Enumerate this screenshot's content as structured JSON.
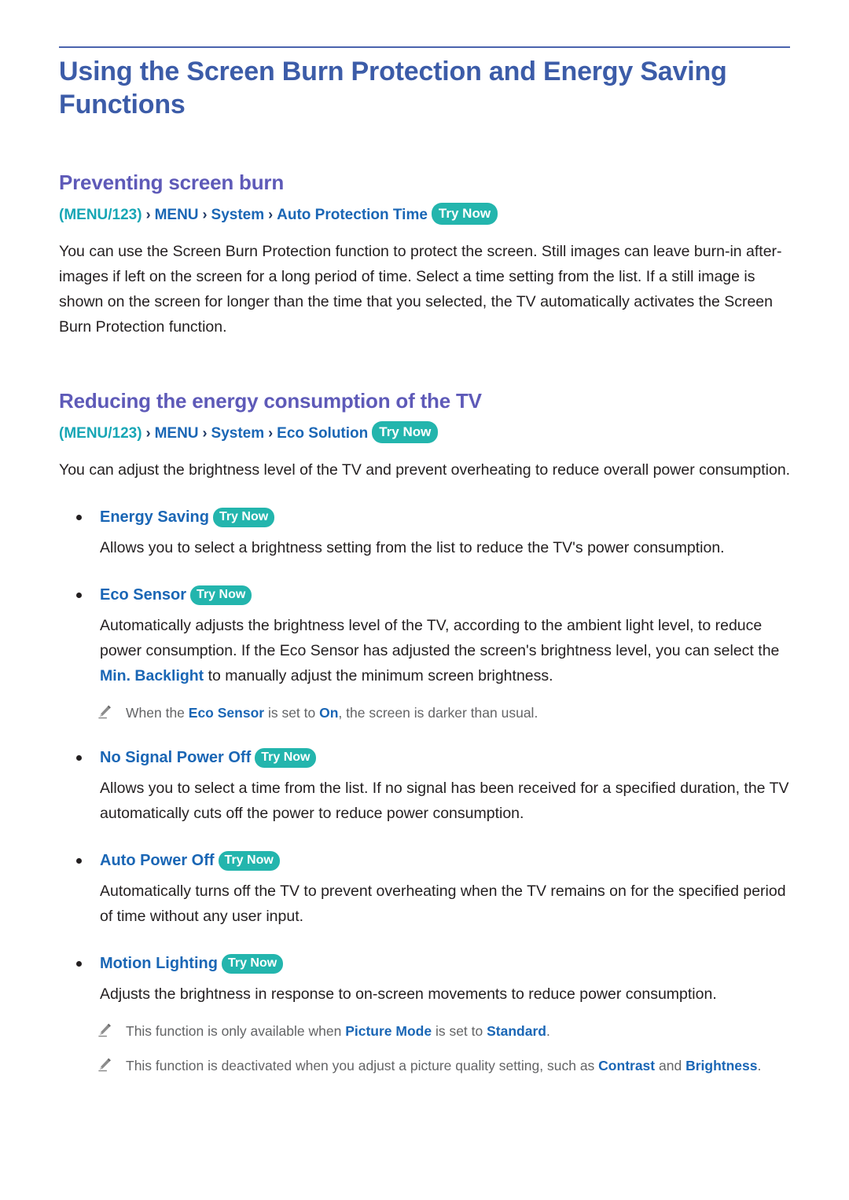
{
  "document": {
    "title": "Using the Screen Burn Protection and Energy Saving Functions"
  },
  "colors": {
    "title": "#3c5ca8",
    "section_heading": "#5e5ab8",
    "link_blue": "#1a66b5",
    "teal": "#23b5ad",
    "teal_text": "#18a6b5",
    "body": "#231f20",
    "note_gray": "#636466"
  },
  "sections": [
    {
      "heading": "Preventing screen burn",
      "breadcrumb": {
        "open_paren": "(",
        "menu123": "MENU/123",
        "close_paren": ")",
        "separator": "›",
        "items": [
          "MENU",
          "System",
          "Auto Protection Time"
        ],
        "try_now": "Try Now"
      },
      "paragraph": "You can use the Screen Burn Protection function to protect the screen. Still images can leave burn-in after-images if left on the screen for a long period of time. Select a time setting from the list. If a still image is shown on the screen for longer than the time that you selected, the TV automatically activates the Screen Burn Protection function."
    },
    {
      "heading": "Reducing the energy consumption of the TV",
      "breadcrumb": {
        "open_paren": "(",
        "menu123": "MENU/123",
        "close_paren": ")",
        "separator": "›",
        "items": [
          "MENU",
          "System",
          "Eco Solution"
        ],
        "try_now": "Try Now"
      },
      "paragraph": "You can adjust the brightness level of the TV and prevent overheating to reduce overall power consumption."
    }
  ],
  "bullets": [
    {
      "label": "Energy Saving",
      "try_now": "Try Now",
      "body_pre": "Allows you to select a brightness setting from the list to reduce the TV's power consumption.",
      "body_hl": "",
      "body_post": ""
    },
    {
      "label": "Eco Sensor",
      "try_now": "Try Now",
      "body_pre": "Automatically adjusts the brightness level of the TV, according to the ambient light level, to reduce power consumption. If the Eco Sensor has adjusted the screen's brightness level, you can select the ",
      "body_hl": "Min. Backlight",
      "body_post": " to manually adjust the minimum screen brightness."
    },
    {
      "label": "No Signal Power Off",
      "try_now": "Try Now",
      "body_pre": "Allows you to select a time from the list. If no signal has been received for a specified duration, the TV automatically cuts off the power to reduce power consumption.",
      "body_hl": "",
      "body_post": ""
    },
    {
      "label": "Auto Power Off",
      "try_now": "Try Now",
      "body_pre": "Automatically turns off the TV to prevent overheating when the TV remains on for the specified period of time without any user input.",
      "body_hl": "",
      "body_post": ""
    },
    {
      "label": "Motion Lighting",
      "try_now": "Try Now",
      "body_pre": "Adjusts the brightness in response to on-screen movements to reduce power consumption.",
      "body_hl": "",
      "body_post": ""
    }
  ],
  "notes": {
    "eco_sensor": {
      "icon": "pencil-icon",
      "pre": "When the ",
      "hl1": "Eco Sensor",
      "mid": " is set to ",
      "hl2": "On",
      "post": ", the screen is darker than usual."
    },
    "motion_lighting_1": {
      "icon": "pencil-icon",
      "pre": "This function is only available when ",
      "hl1": "Picture Mode",
      "mid": " is set to ",
      "hl2": "Standard",
      "post": "."
    },
    "motion_lighting_2": {
      "icon": "pencil-icon",
      "pre": "This function is deactivated when you adjust a picture quality setting, such as ",
      "hl1": "Contrast",
      "mid": " and ",
      "hl2": "Brightness",
      "post": "."
    }
  }
}
